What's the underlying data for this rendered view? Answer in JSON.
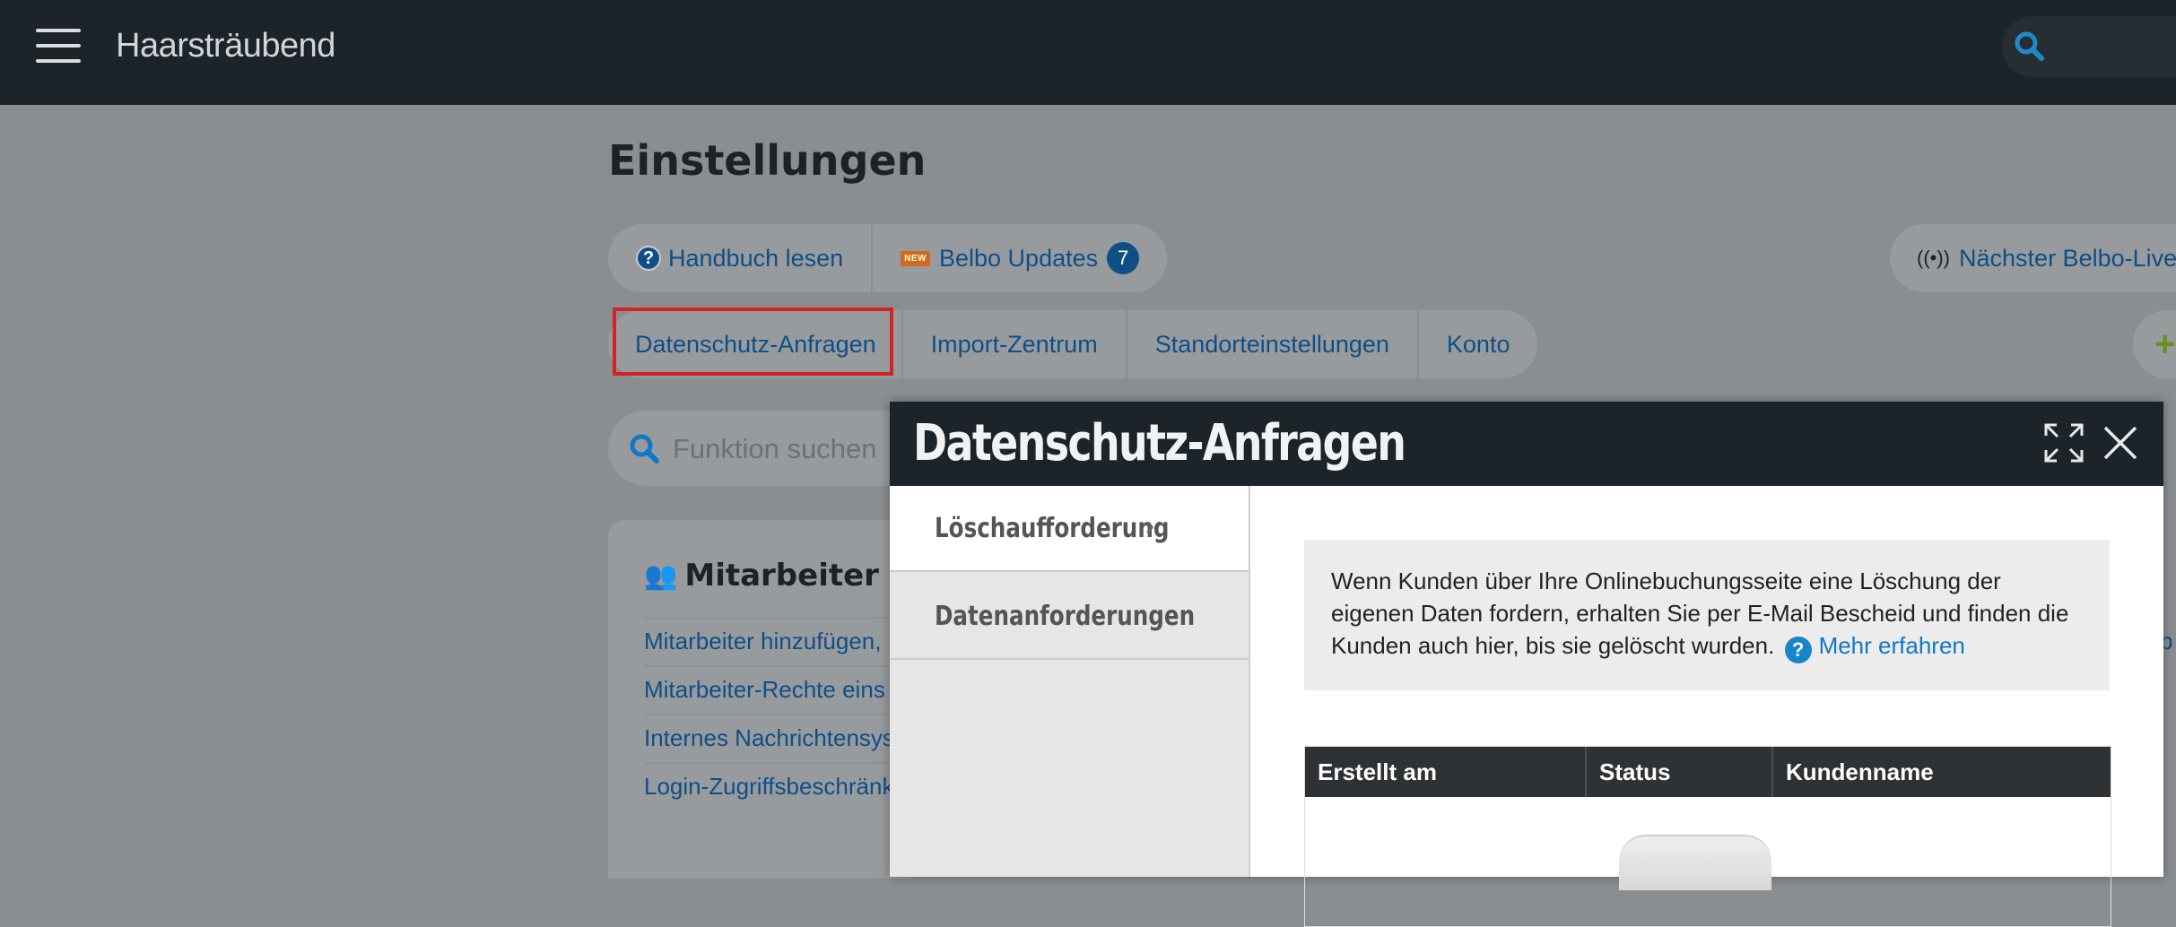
{
  "app": {
    "name": "Haarsträubend"
  },
  "page": {
    "title": "Einstellungen"
  },
  "help_bar": {
    "manual_label": "Handbuch lesen",
    "updates_label": "Belbo Updates",
    "updates_new_badge": "NEW",
    "updates_count": "7",
    "live_label": "Nächster Belbo-Lives"
  },
  "tabs": [
    {
      "label": "Datenschutz-Anfragen"
    },
    {
      "label": "Import-Zentrum"
    },
    {
      "label": "Standorteinstellungen"
    },
    {
      "label": "Konto"
    }
  ],
  "function_search": {
    "placeholder": "Funktion suchen"
  },
  "staff_card": {
    "title": "Mitarbeiter",
    "links": [
      "Mitarbeiter hinzufügen, ",
      "Mitarbeiter-Rechte eins",
      "Internes Nachrichtensys",
      "Login-Zugriffsbeschränk"
    ]
  },
  "right_edge_text": "b",
  "modal": {
    "title": "Datenschutz-Anfragen",
    "sidebar": [
      {
        "label": "Löschaufforderung",
        "active": true
      },
      {
        "label": "Datenanforderungen",
        "active": false
      }
    ],
    "info_text": "Wenn Kunden über Ihre Onlinebuchungsseite eine Löschung der eigenen Daten fordern, erhalten Sie per E-Mail Bescheid und finden die Kunden auch hier, bis sie gelöscht wurden.",
    "info_link": "Mehr erfahren",
    "table_headers": [
      "Erstellt am",
      "Status",
      "Kundenname"
    ]
  },
  "colors": {
    "topbar": "#1c2329",
    "link": "#0f4e86",
    "highlight": "#d0232a",
    "help_icon": "#1686c9"
  }
}
